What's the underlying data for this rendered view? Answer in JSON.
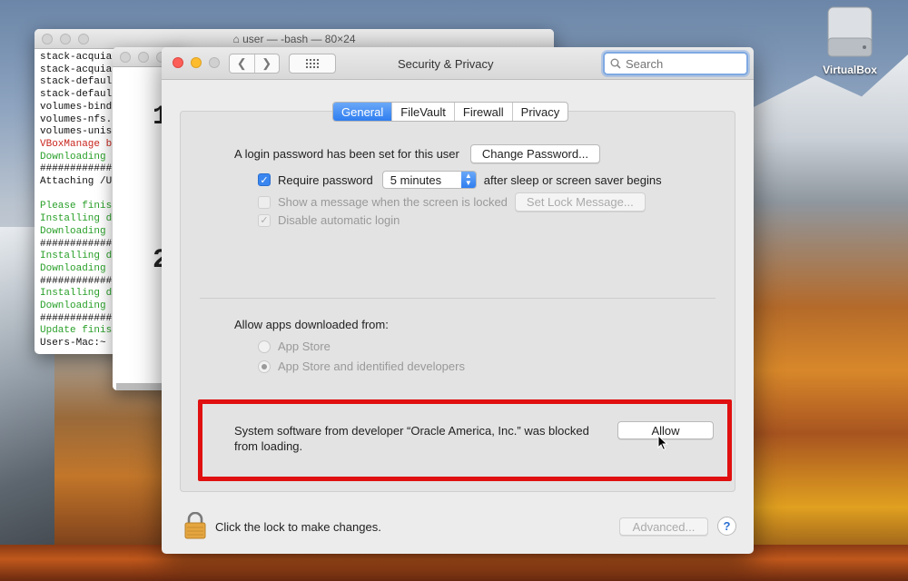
{
  "desktop": {
    "icons": [
      {
        "name": "harddisk-icon",
        "label": "VirtualBox"
      }
    ]
  },
  "terminal_back": {
    "title": "user — -bash — 80×24",
    "lines": [
      {
        "text": "stack-acquia",
        "color": "black"
      },
      {
        "text": "stack-acquia",
        "color": "black"
      },
      {
        "text": "stack-defaul",
        "color": "black"
      },
      {
        "text": "stack-defaul",
        "color": "black"
      },
      {
        "text": "volumes-bind",
        "color": "black"
      },
      {
        "text": "volumes-nfs.",
        "color": "black"
      },
      {
        "text": "volumes-unis",
        "color": "black"
      },
      {
        "text": "VBoxManage b",
        "color": "red"
      },
      {
        "text": "Downloading",
        "color": "green"
      },
      {
        "text": "############",
        "color": "black"
      },
      {
        "text": "Attaching /U",
        "color": "black"
      },
      {
        "text": "",
        "color": "black"
      },
      {
        "text": "Please finis",
        "color": "green"
      },
      {
        "text": "Installing d",
        "color": "green"
      },
      {
        "text": "Downloading",
        "color": "green"
      },
      {
        "text": "############",
        "color": "black"
      },
      {
        "text": "Installing d",
        "color": "green"
      },
      {
        "text": "Downloading",
        "color": "green"
      },
      {
        "text": "############",
        "color": "black"
      },
      {
        "text": "Installing d",
        "color": "green"
      },
      {
        "text": "Downloading",
        "color": "green"
      },
      {
        "text": "############",
        "color": "black"
      },
      {
        "text": "Update finis",
        "color": "green"
      },
      {
        "text": "Users-Mac:~",
        "color": "black"
      }
    ]
  },
  "terminal_mid": {
    "big_chars": [
      "1",
      "2"
    ]
  },
  "window": {
    "title": "Security & Privacy",
    "search_placeholder": "Search",
    "tabs": [
      {
        "label": "General",
        "active": true
      },
      {
        "label": "FileVault",
        "active": false
      },
      {
        "label": "Firewall",
        "active": false
      },
      {
        "label": "Privacy",
        "active": false
      }
    ],
    "login_password_text": "A login password has been set for this user",
    "change_password_label": "Change Password...",
    "require_password_label": "Require password",
    "require_password_value": "5 minutes",
    "after_sleep_text": "after sleep or screen saver begins",
    "show_message_label": "Show a message when the screen is locked",
    "set_lock_message_label": "Set Lock Message...",
    "disable_auto_login_label": "Disable automatic login",
    "allow_apps_label": "Allow apps downloaded from:",
    "radio_app_store": "App Store",
    "radio_identified": "App Store and identified developers",
    "blocked_text": "System software from developer “Oracle America, Inc.” was blocked from loading.",
    "allow_label": "Allow",
    "lock_text": "Click the lock to make changes.",
    "advanced_label": "Advanced...",
    "help_label": "?"
  },
  "colors": {
    "accent": "#2f7ef0",
    "highlight_border": "#e01010",
    "terminal_red": "#c8241c",
    "terminal_green": "#2aa02a"
  }
}
